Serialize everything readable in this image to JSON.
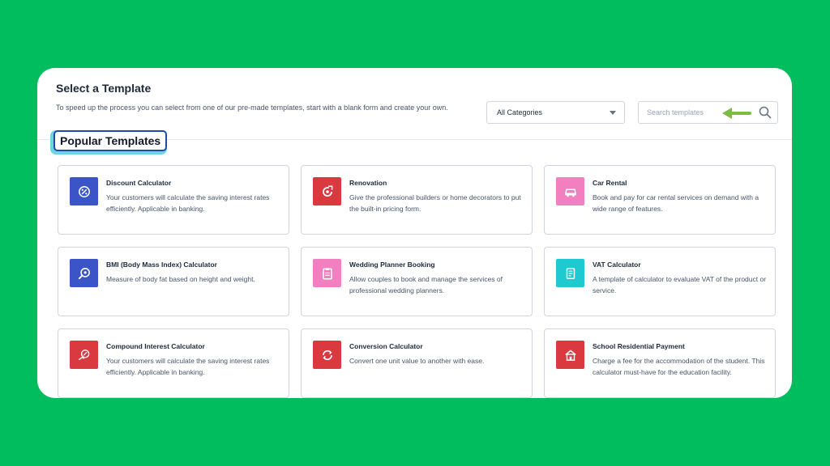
{
  "header": {
    "title": "Select a Template",
    "description": "To speed up the process you can select from one of our pre-made templates, start with a blank form and create your own."
  },
  "filter": {
    "selected": "All Categories"
  },
  "search": {
    "placeholder": "Search templates"
  },
  "section_title": "Popular Templates",
  "colors": {
    "background": "#02bd5d",
    "blue": "#3b55c9",
    "red": "#d9393f",
    "pink": "#f27fbf",
    "cyan": "#1fc9d2",
    "highlight_border": "#1f4ba8",
    "highlight_shadow": "#6fd3e6",
    "hint_arrow": "#7dbb43"
  },
  "templates": [
    {
      "name": "Discount Calculator",
      "description": "Your customers will calculate the saving interest rates efficiently. Applicable in banking.",
      "icon": "discount-icon",
      "color": "#3b55c9"
    },
    {
      "name": "Renovation",
      "description": "Give the professional builders or home decorators to put the built-in pricing form.",
      "icon": "renovation-icon",
      "color": "#d9393f"
    },
    {
      "name": "Car Rental",
      "description": "Book and pay for car rental services on demand with a wide range of features.",
      "icon": "car-icon",
      "color": "#f27fbf"
    },
    {
      "name": "BMI (Body Mass Index) Calculator",
      "description": "Measure of body fat based on height and weight.",
      "icon": "scale-icon",
      "color": "#3b55c9"
    },
    {
      "name": "Wedding Planner Booking",
      "description": "Allow couples to book and manage the services of professional wedding planners.",
      "icon": "clipboard-icon",
      "color": "#f27fbf"
    },
    {
      "name": "VAT Calculator",
      "description": "A template of calculator to evaluate VAT of the product or service.",
      "icon": "receipt-icon",
      "color": "#1fc9d2"
    },
    {
      "name": "Compound Interest Calculator",
      "description": "Your customers will calculate the saving interest rates efficiently. Applicable in banking.",
      "icon": "percent-hand-icon",
      "color": "#d9393f"
    },
    {
      "name": "Conversion Calculator",
      "description": "Convert one unit value to another with ease.",
      "icon": "conversion-icon",
      "color": "#d9393f"
    },
    {
      "name": "School Residential Payment",
      "description": "Charge a fee for the accommodation of the student. This calculator must-have for the education facility.",
      "icon": "school-icon",
      "color": "#d9393f"
    }
  ]
}
